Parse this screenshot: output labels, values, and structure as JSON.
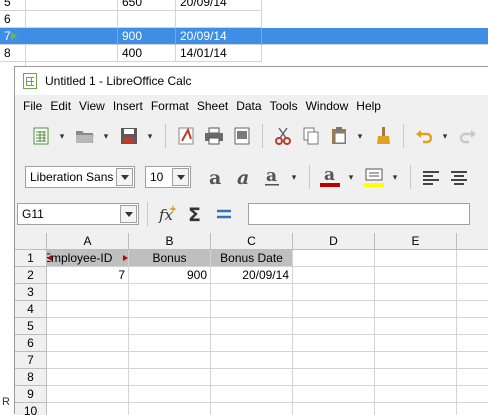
{
  "background_sheet": {
    "rows": [
      {
        "num": "5",
        "col1": "",
        "col2": "650",
        "col3": "20/09/14"
      },
      {
        "num": "6",
        "col1": "",
        "col2": "",
        "col3": ""
      },
      {
        "num": "7",
        "col1": "",
        "col2": "900",
        "col3": "20/09/14",
        "selected": true
      },
      {
        "num": "8",
        "col1": "",
        "col2": "400",
        "col3": "14/01/14"
      }
    ],
    "status_left": "R"
  },
  "window": {
    "title": "Untitled 1 - LibreOffice Calc"
  },
  "menu": [
    "File",
    "Edit",
    "View",
    "Insert",
    "Format",
    "Sheet",
    "Data",
    "Tools",
    "Window",
    "Help"
  ],
  "toolbar": {
    "font_name": "Liberation Sans",
    "font_size": "10"
  },
  "formula_bar": {
    "name_box": "G11",
    "formula": ""
  },
  "sheet": {
    "columns": [
      "A",
      "B",
      "C",
      "D",
      "E"
    ],
    "rows": [
      "1",
      "2",
      "3",
      "4",
      "5",
      "6",
      "7",
      "8",
      "9",
      "10"
    ],
    "header_row": [
      "Employee-ID",
      "Bonus",
      "Bonus Date"
    ],
    "data_row": [
      "7",
      "900",
      "20/09/14"
    ]
  },
  "colors": {
    "selection": "#3d8ee4",
    "header_fill": "#bfbfbf",
    "calc_green": "#6aa84f",
    "font_color_red": "#c00000",
    "highlight_yellow": "#ffff00"
  }
}
